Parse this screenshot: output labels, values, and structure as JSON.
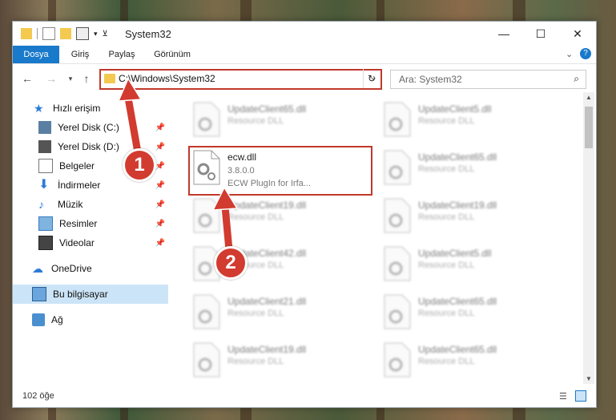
{
  "window": {
    "title": "System32"
  },
  "ribbon": {
    "tabs": [
      {
        "label": "Dosya",
        "active": true
      },
      {
        "label": "Giriş"
      },
      {
        "label": "Paylaş"
      },
      {
        "label": "Görünüm"
      }
    ]
  },
  "address": {
    "path": "C:\\Windows\\System32"
  },
  "search": {
    "placeholder": "Ara: System32"
  },
  "sidebar": {
    "quick_access": "Hızlı erişim",
    "items": [
      {
        "label": "Yerel Disk (C:)",
        "pinned": true
      },
      {
        "label": "Yerel Disk (D:)",
        "pinned": true
      },
      {
        "label": "Belgeler",
        "pinned": true
      },
      {
        "label": "İndirmeler",
        "pinned": true
      },
      {
        "label": "Müzik",
        "pinned": true
      },
      {
        "label": "Resimler",
        "pinned": true
      },
      {
        "label": "Videolar",
        "pinned": true
      }
    ],
    "onedrive": "OneDrive",
    "this_pc": "Bu bilgisayar",
    "network": "Ağ"
  },
  "files": {
    "selected": {
      "name": "ecw.dll",
      "version": "3.8.0.0",
      "description": "ECW PlugIn for Irfa..."
    },
    "left_col": [
      {
        "name": "UpdateClient65.dll",
        "type": "Resource DLL"
      },
      {
        "name": "UpdateClient19.dll",
        "type": "Resource DLL"
      },
      {
        "name": "UpdateClient42.dll",
        "type": "Resource DLL"
      },
      {
        "name": "UpdateClient21.dll",
        "type": "Resource DLL"
      },
      {
        "name": "UpdateClient19.dll",
        "type": "Resource DLL"
      }
    ],
    "right_col": [
      {
        "name": "UpdateClient5.dll",
        "type": "Resource DLL"
      },
      {
        "name": "UpdateClient65.dll",
        "type": "Resource DLL"
      },
      {
        "name": "UpdateClient19.dll",
        "type": "Resource DLL"
      },
      {
        "name": "UpdateClient5.dll",
        "type": "Resource DLL"
      },
      {
        "name": "UpdateClient65.dll",
        "type": "Resource DLL"
      },
      {
        "name": "UpdateClient65.dll",
        "type": "Resource DLL"
      }
    ]
  },
  "status": {
    "count": "102 öğe"
  },
  "callouts": {
    "one": "1",
    "two": "2"
  },
  "colors": {
    "accent": "#1979ca",
    "highlight": "#c0392b",
    "callout": "#d23b2f"
  }
}
